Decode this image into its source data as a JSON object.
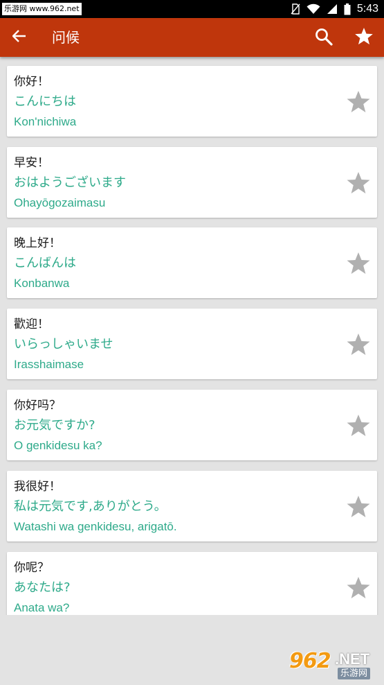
{
  "status_bar": {
    "watermark": "乐游网 www.962.net",
    "time": "5:43"
  },
  "app_bar": {
    "title": "问候",
    "back_icon": "arrow-left-icon",
    "search_icon": "search-icon",
    "favorite_icon": "star-icon"
  },
  "colors": {
    "app_bar": "#bf360c",
    "accent_text": "#2eaa8a",
    "star_inactive": "#b0b0b0",
    "background": "#e3e3e3"
  },
  "phrases": [
    {
      "chinese": "你好！",
      "japanese": "こんにちは",
      "romaji": "Kon'nichiwa"
    },
    {
      "chinese": "早安！",
      "japanese": "おはようございます",
      "romaji": "Ohayōgozaimasu"
    },
    {
      "chinese": "晚上好！",
      "japanese": "こんばんは",
      "romaji": "Konbanwa"
    },
    {
      "chinese": "歡迎！",
      "japanese": "いらっしゃいませ",
      "romaji": "Irasshaimase"
    },
    {
      "chinese": "你好吗？",
      "japanese": "お元気ですか?",
      "romaji": "O genkidesu ka?"
    },
    {
      "chinese": "我很好！",
      "japanese": "私は元気です,ありがとう。",
      "romaji": "Watashi wa genkidesu, arigatō."
    },
    {
      "chinese": "你呢？",
      "japanese": "あなたは?",
      "romaji": "Anata wa?"
    }
  ],
  "watermark_logo": {
    "number": "962",
    "suffix": ".NET",
    "site_name": "乐游网"
  }
}
